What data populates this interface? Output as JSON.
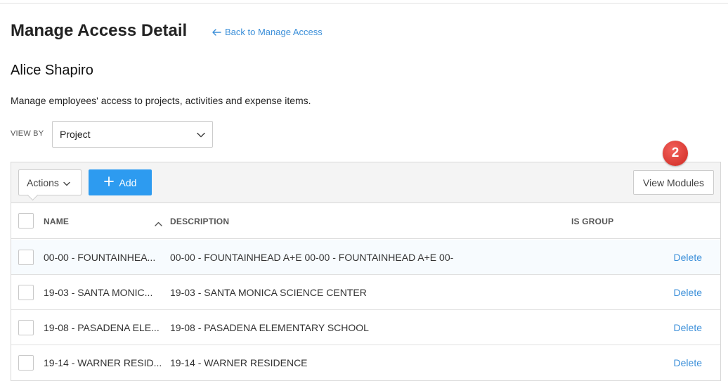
{
  "header": {
    "title": "Manage Access Detail",
    "back_link": "Back to Manage Access"
  },
  "employee": {
    "name": "Alice Shapiro",
    "subtitle": "Manage employees' access to projects, activities and expense items."
  },
  "view_by": {
    "label": "VIEW BY",
    "selected": "Project"
  },
  "toolbar": {
    "actions_label": "Actions",
    "add_label": "Add",
    "view_modules_label": "View Modules",
    "badge_count": "2"
  },
  "table": {
    "columns": [
      "NAME",
      "DESCRIPTION",
      "IS GROUP"
    ],
    "rows": [
      {
        "name": "00-00 - FOUNTAINHEA...",
        "description": "00-00 - FOUNTAINHEAD A+E 00-00 - FOUNTAINHEAD A+E 00-",
        "is_group": "",
        "action": "Delete"
      },
      {
        "name": "19-03 - SANTA MONIC...",
        "description": "19-03 - SANTA MONICA SCIENCE CENTER",
        "is_group": "",
        "action": "Delete"
      },
      {
        "name": "19-08 - PASADENA ELE...",
        "description": "19-08 - PASADENA ELEMENTARY SCHOOL",
        "is_group": "",
        "action": "Delete"
      },
      {
        "name": "19-14 - WARNER RESID...",
        "description": "19-14 - WARNER RESIDENCE",
        "is_group": "",
        "action": "Delete"
      }
    ]
  },
  "colors": {
    "accent": "#2d9bf0",
    "link": "#3b8fd9",
    "badge": "#e0443d"
  },
  "icons": {
    "back": "arrow-left-icon",
    "dropdown": "chevron-down-icon",
    "add": "plus-icon",
    "sort": "chevron-up-icon"
  }
}
